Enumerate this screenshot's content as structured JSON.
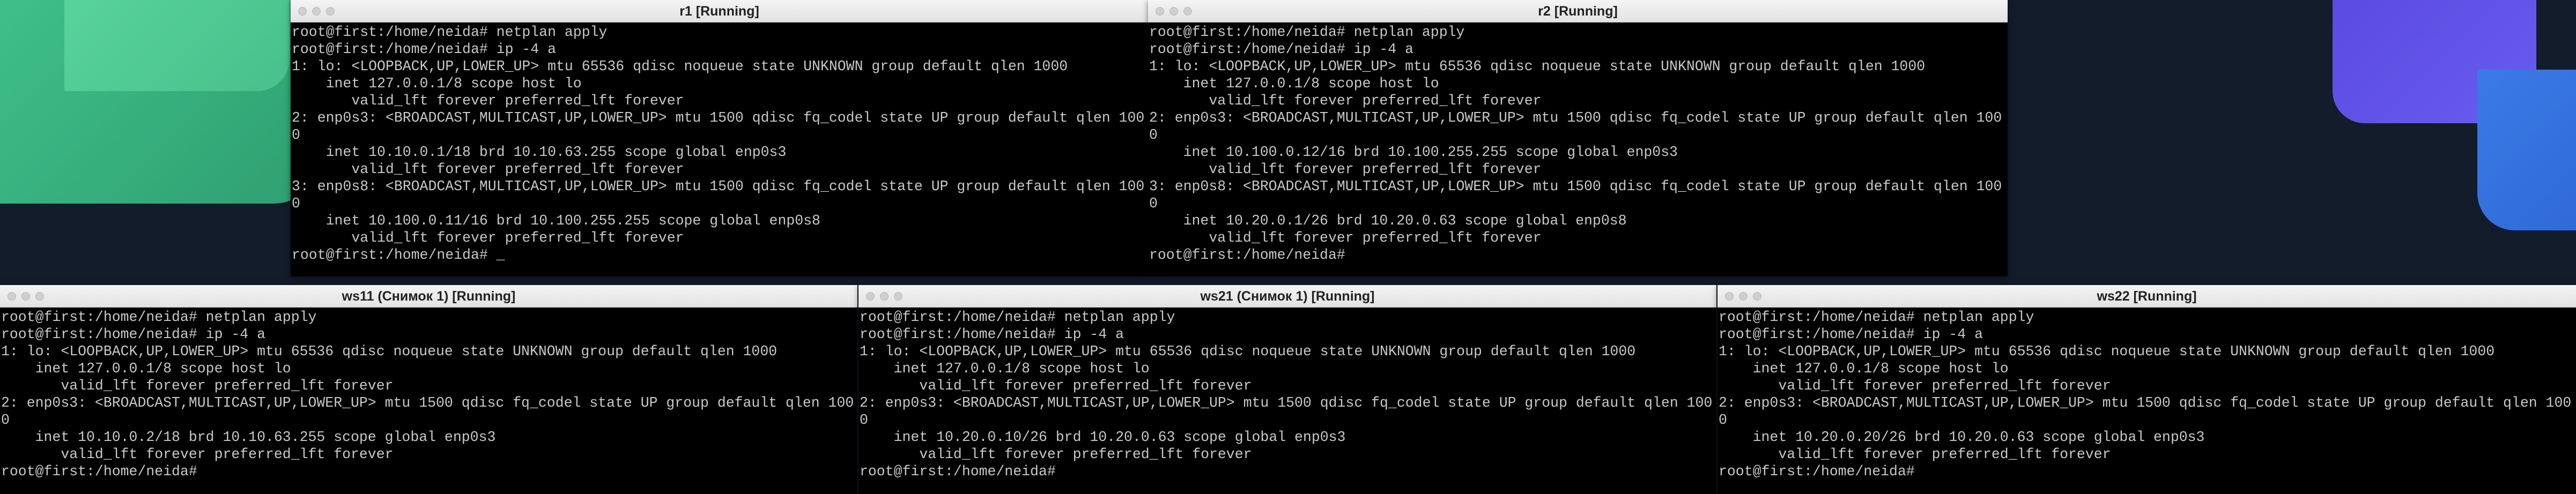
{
  "windows": [
    {
      "title": "r1 [Running]",
      "lines": [
        "root@first:/home/neida# netplan apply",
        "root@first:/home/neida# ip -4 a",
        "1: lo: <LOOPBACK,UP,LOWER_UP> mtu 65536 qdisc noqueue state UNKNOWN group default qlen 1000",
        "    inet 127.0.0.1/8 scope host lo",
        "       valid_lft forever preferred_lft forever",
        "2: enp0s3: <BROADCAST,MULTICAST,UP,LOWER_UP> mtu 1500 qdisc fq_codel state UP group default qlen 100",
        "0",
        "    inet 10.10.0.1/18 brd 10.10.63.255 scope global enp0s3",
        "       valid_lft forever preferred_lft forever",
        "3: enp0s8: <BROADCAST,MULTICAST,UP,LOWER_UP> mtu 1500 qdisc fq_codel state UP group default qlen 100",
        "0",
        "    inet 10.100.0.11/16 brd 10.100.255.255 scope global enp0s8",
        "       valid_lft forever preferred_lft forever",
        "root@first:/home/neida# _"
      ]
    },
    {
      "title": "r2 [Running]",
      "lines": [
        "root@first:/home/neida# netplan apply",
        "root@first:/home/neida# ip -4 a",
        "1: lo: <LOOPBACK,UP,LOWER_UP> mtu 65536 qdisc noqueue state UNKNOWN group default qlen 1000",
        "    inet 127.0.0.1/8 scope host lo",
        "       valid_lft forever preferred_lft forever",
        "2: enp0s3: <BROADCAST,MULTICAST,UP,LOWER_UP> mtu 1500 qdisc fq_codel state UP group default qlen 100",
        "0",
        "    inet 10.100.0.12/16 brd 10.100.255.255 scope global enp0s3",
        "       valid_lft forever preferred_lft forever",
        "3: enp0s8: <BROADCAST,MULTICAST,UP,LOWER_UP> mtu 1500 qdisc fq_codel state UP group default qlen 100",
        "0",
        "    inet 10.20.0.1/26 brd 10.20.0.63 scope global enp0s8",
        "       valid_lft forever preferred_lft forever",
        "root@first:/home/neida#"
      ]
    },
    {
      "title": "ws11 (Снимок 1) [Running]",
      "lines": [
        "root@first:/home/neida# netplan apply",
        "root@first:/home/neida# ip -4 a",
        "1: lo: <LOOPBACK,UP,LOWER_UP> mtu 65536 qdisc noqueue state UNKNOWN group default qlen 1000",
        "    inet 127.0.0.1/8 scope host lo",
        "       valid_lft forever preferred_lft forever",
        "2: enp0s3: <BROADCAST,MULTICAST,UP,LOWER_UP> mtu 1500 qdisc fq_codel state UP group default qlen 100",
        "0",
        "    inet 10.10.0.2/18 brd 10.10.63.255 scope global enp0s3",
        "       valid_lft forever preferred_lft forever",
        "root@first:/home/neida#"
      ]
    },
    {
      "title": "ws21 (Снимок 1) [Running]",
      "lines": [
        "root@first:/home/neida# netplan apply",
        "root@first:/home/neida# ip -4 a",
        "1: lo: <LOOPBACK,UP,LOWER_UP> mtu 65536 qdisc noqueue state UNKNOWN group default qlen 1000",
        "    inet 127.0.0.1/8 scope host lo",
        "       valid_lft forever preferred_lft forever",
        "2: enp0s3: <BROADCAST,MULTICAST,UP,LOWER_UP> mtu 1500 qdisc fq_codel state UP group default qlen 100",
        "0",
        "    inet 10.20.0.10/26 brd 10.20.0.63 scope global enp0s3",
        "       valid_lft forever preferred_lft forever",
        "root@first:/home/neida#"
      ]
    },
    {
      "title": "ws22 [Running]",
      "lines": [
        "root@first:/home/neida# netplan apply",
        "root@first:/home/neida# ip -4 a",
        "1: lo: <LOOPBACK,UP,LOWER_UP> mtu 65536 qdisc noqueue state UNKNOWN group default qlen 1000",
        "    inet 127.0.0.1/8 scope host lo",
        "       valid_lft forever preferred_lft forever",
        "2: enp0s3: <BROADCAST,MULTICAST,UP,LOWER_UP> mtu 1500 qdisc fq_codel state UP group default qlen 100",
        "0",
        "    inet 10.20.0.20/26 brd 10.20.0.63 scope global enp0s3",
        "       valid_lft forever preferred_lft forever",
        "root@first:/home/neida#"
      ]
    }
  ]
}
